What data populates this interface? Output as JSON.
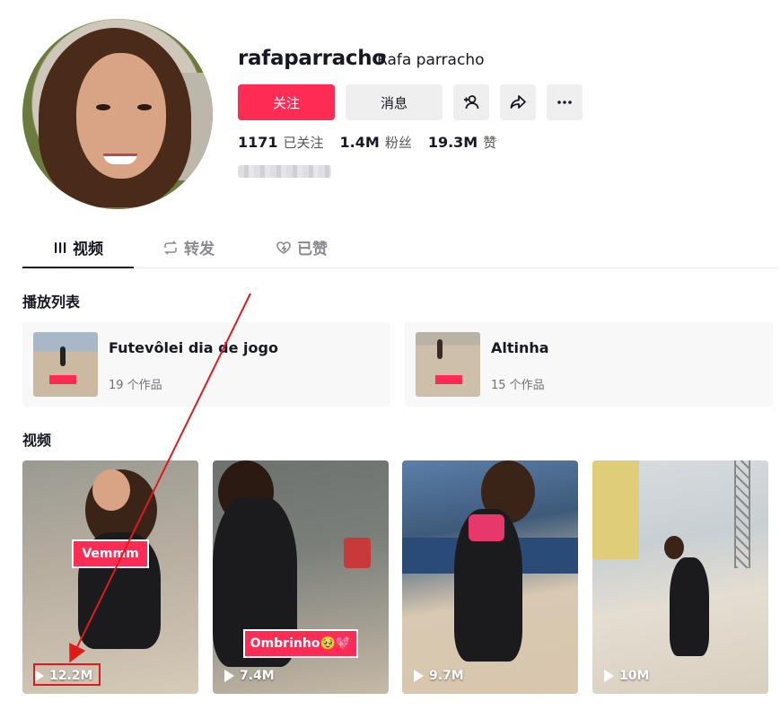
{
  "profile": {
    "username": "rafaparracho",
    "nickname": "Rafa parracho",
    "follow_label": "关注",
    "message_label": "消息",
    "stats": [
      {
        "value": "1171",
        "label": "已关注"
      },
      {
        "value": "1.4M",
        "label": "粉丝"
      },
      {
        "value": "19.3M",
        "label": "赞"
      }
    ]
  },
  "tabs": [
    {
      "label": "视频",
      "icon": "grid-icon"
    },
    {
      "label": "转发",
      "icon": "repost-icon"
    },
    {
      "label": "已赞",
      "icon": "heart-icon"
    }
  ],
  "playlists_section": {
    "title": "播放列表",
    "items": [
      {
        "name": "Futevôlei dia de jogo",
        "count": "19 个作品"
      },
      {
        "name": "Altinha",
        "count": "15 个作品"
      }
    ]
  },
  "videos_section": {
    "title": "视频",
    "items": [
      {
        "caption": "Vemmm",
        "views": "12.2M"
      },
      {
        "caption": "Ombrinho🥹💖",
        "views": "7.4M"
      },
      {
        "caption": "",
        "views": "9.7M"
      },
      {
        "caption": "",
        "views": "10M"
      }
    ]
  },
  "colors": {
    "accent": "#fe2c55",
    "annotation": "#e01a1a"
  }
}
